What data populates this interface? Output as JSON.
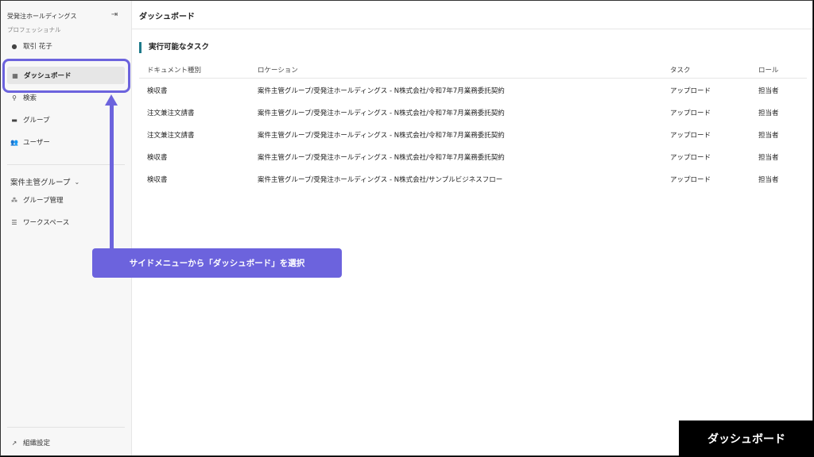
{
  "sidebar": {
    "org_name": "受発注ホールディングス",
    "plan": "プロフェッショナル",
    "user_name": "取引 花子",
    "items": [
      {
        "label": "ダッシュボード"
      },
      {
        "label": "検索"
      },
      {
        "label": "グループ"
      },
      {
        "label": "ユーザー"
      }
    ],
    "group_title": "案件主管グループ",
    "group_items": [
      {
        "label": "グループ管理"
      },
      {
        "label": "ワークスペース"
      }
    ],
    "settings_label": "組織設定"
  },
  "header": {
    "title": "ダッシュボード"
  },
  "main": {
    "section_title": "実行可能なタスク",
    "columns": [
      "ドキュメント種別",
      "ロケーション",
      "タスク",
      "ロール"
    ],
    "rows": [
      [
        "検収書",
        "案件主管グループ/受発注ホールディングス - N株式会社/令和7年7月業務委託契約",
        "アップロード",
        "担当者"
      ],
      [
        "注文兼注文請書",
        "案件主管グループ/受発注ホールディングス - N株式会社/令和7年7月業務委託契約",
        "アップロード",
        "担当者"
      ],
      [
        "注文兼注文請書",
        "案件主管グループ/受発注ホールディングス - N株式会社/令和7年7月業務委託契約",
        "アップロード",
        "担当者"
      ],
      [
        "検収書",
        "案件主管グループ/受発注ホールディングス - N株式会社/令和7年7月業務委託契約",
        "アップロード",
        "担当者"
      ],
      [
        "検収書",
        "案件主管グループ/受発注ホールディングス - N株式会社/サンプルビジネスフロー",
        "アップロード",
        "担当者"
      ]
    ]
  },
  "callout": {
    "text": "サイドメニューから「ダッシュボード」を選択"
  },
  "badge": {
    "text": "ダッシュボード"
  },
  "colors": {
    "accent": "#6c63dd",
    "section_bar": "#1e7a8a"
  }
}
